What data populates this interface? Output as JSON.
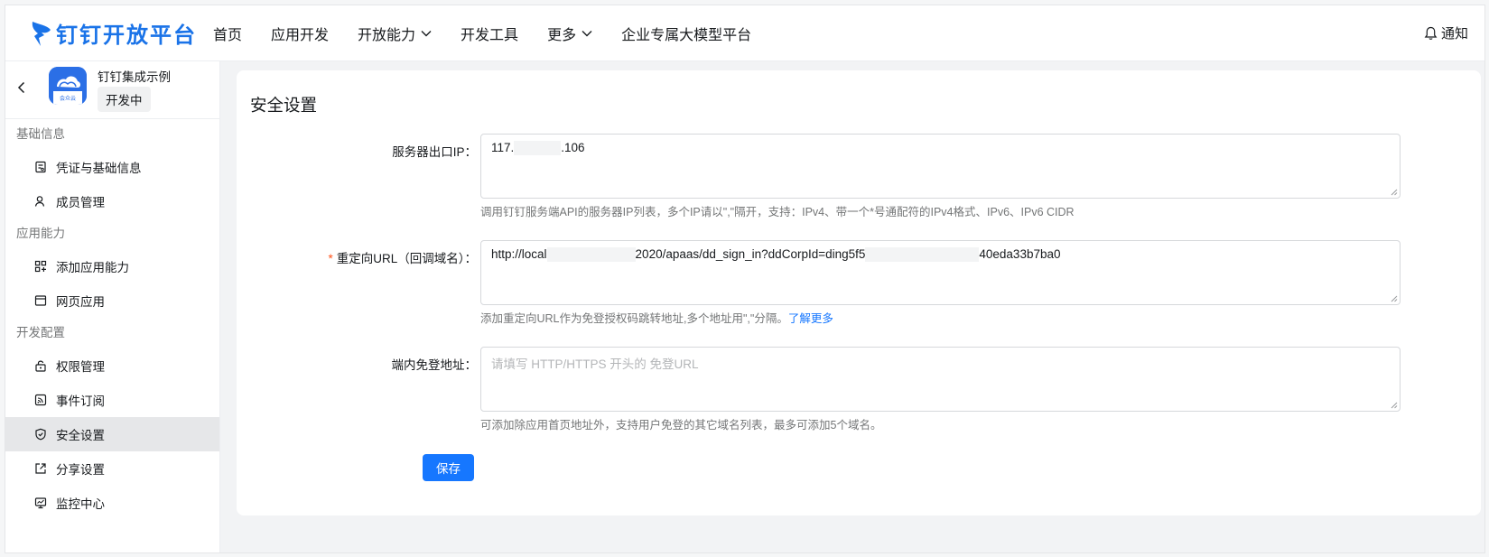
{
  "brand": {
    "name": "钉钉开放平台"
  },
  "nav": {
    "items": [
      {
        "label": "首页"
      },
      {
        "label": "应用开发"
      },
      {
        "label": "开放能力"
      },
      {
        "label": "开发工具"
      },
      {
        "label": "更多"
      },
      {
        "label": "企业专属大模型平台"
      }
    ],
    "notify_label": "通知"
  },
  "app": {
    "name": "钉钉集成示例",
    "status": "开发中",
    "logo_text": "会众云"
  },
  "sidebar": {
    "groups": [
      {
        "title": "基础信息",
        "items": [
          {
            "label": "凭证与基础信息"
          },
          {
            "label": "成员管理"
          }
        ]
      },
      {
        "title": "应用能力",
        "items": [
          {
            "label": "添加应用能力"
          },
          {
            "label": "网页应用"
          }
        ]
      },
      {
        "title": "开发配置",
        "items": [
          {
            "label": "权限管理"
          },
          {
            "label": "事件订阅"
          },
          {
            "label": "安全设置"
          },
          {
            "label": "分享设置"
          },
          {
            "label": "监控中心"
          }
        ]
      }
    ]
  },
  "main": {
    "title": "安全设置",
    "fields": [
      {
        "label": "服务器出口IP：",
        "value_prefix": "117.",
        "value_suffix": ".106",
        "hint": "调用钉钉服务端API的服务器IP列表，多个IP请以\",\"隔开，支持：IPv4、带一个*号通配符的IPv4格式、IPv6、IPv6 CIDR"
      },
      {
        "required_mark": "*",
        "label": "重定向URL（回调域名）：",
        "value_part1": "http://local",
        "value_part2": "2020/apaas/dd_sign_in?ddCorpId=ding5f5",
        "value_part3": "40eda33b7ba0",
        "hint": "添加重定向URL作为免登授权码跳转地址,多个地址用\",\"分隔。",
        "hint_link": "了解更多"
      },
      {
        "label": "端内免登地址：",
        "placeholder": "请填写 HTTP/HTTPS 开头的 免登URL",
        "hint": "可添加除应用首页地址外，支持用户免登的其它域名列表，最多可添加5个域名。"
      }
    ],
    "save_label": "保存"
  },
  "colors": {
    "primary": "#1677ff",
    "brand": "#1a73e8",
    "required": "#ff5219"
  },
  "icons": [
    "dingtalk-logo-icon",
    "chevron-down-icon",
    "bell-icon",
    "chevron-left-icon",
    "credential-icon",
    "member-icon",
    "add-apps-icon",
    "webpage-icon",
    "lock-icon",
    "rss-icon",
    "shield-icon",
    "share-icon",
    "monitor-icon"
  ]
}
